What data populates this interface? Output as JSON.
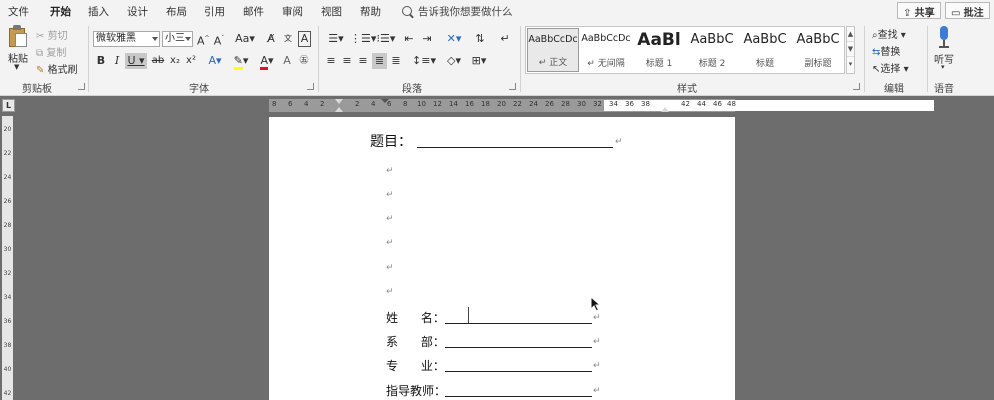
{
  "tabs": [
    "文件",
    "开始",
    "插入",
    "设计",
    "布局",
    "引用",
    "邮件",
    "审阅",
    "视图",
    "帮助"
  ],
  "active_tab": "开始",
  "tell_me": "告诉我你想要做什么",
  "share_label": "共享",
  "comments_label": "批注",
  "clipboard": {
    "paste": "粘贴",
    "cut": "剪切",
    "copy": "复制",
    "format_painter": "格式刷",
    "group": "剪贴板"
  },
  "font": {
    "name": "微软雅黑",
    "size": "小三",
    "group": "字体"
  },
  "paragraph": {
    "group": "段落"
  },
  "styles": {
    "group": "样式",
    "items": [
      {
        "sample": "AaBbCcDc",
        "name": "正文"
      },
      {
        "sample": "AaBbCcDc",
        "name": "无间隔"
      },
      {
        "sample": "AaBl",
        "name": "标题 1"
      },
      {
        "sample": "AaBbC",
        "name": "标题 2"
      },
      {
        "sample": "AaBbC",
        "name": "标题"
      },
      {
        "sample": "AaBbC",
        "name": "副标题"
      }
    ]
  },
  "editing": {
    "find": "查找",
    "replace": "替换",
    "select": "选择",
    "group": "编辑"
  },
  "voice": {
    "dictate": "听写",
    "group": "语音"
  },
  "ruler": {
    "corner": "L",
    "ticks": [
      "8",
      "6",
      "4",
      "2",
      "2",
      "4",
      "6",
      "8",
      "10",
      "12",
      "14",
      "16",
      "18",
      "20",
      "22",
      "24",
      "26",
      "28",
      "30",
      "32",
      "34",
      "36",
      "38",
      "42",
      "44",
      "46",
      "48"
    ],
    "vticks": [
      "20",
      "22",
      "24",
      "26",
      "28",
      "30",
      "32",
      "34",
      "36",
      "38",
      "40",
      "42"
    ]
  },
  "document": {
    "title_label": "题目：",
    "paragraph_mark": "↵",
    "fields": [
      {
        "label": "姓      名："
      },
      {
        "label": "系      部："
      },
      {
        "label": "专      业："
      },
      {
        "label": "指导教师："
      }
    ]
  },
  "colors": {
    "accent": "#2b579a",
    "highlight": "#ffff00",
    "font_color": "#e81123"
  }
}
